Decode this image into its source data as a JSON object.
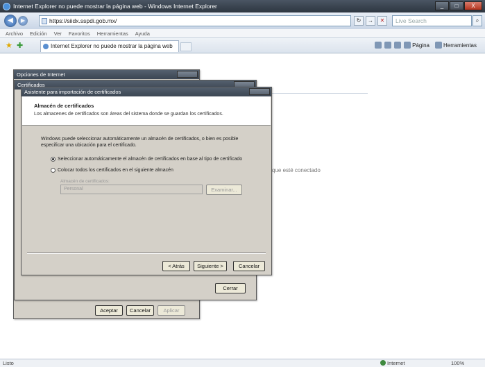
{
  "browser": {
    "title": "Internet Explorer no puede mostrar la página web - Windows Internet Explorer",
    "window_buttons": [
      "_",
      "□",
      "X"
    ],
    "address": "https://siidx.sspdi.gob.mx/",
    "search_placeholder": "Live Search",
    "menu": [
      "Archivo",
      "Edición",
      "Ver",
      "Favoritos",
      "Herramientas",
      "Ayuda"
    ],
    "tab_title": "Internet Explorer no puede mostrar la página web",
    "toolbar": {
      "page": "Página",
      "tools": "Herramientas"
    },
    "status_left": "Listo",
    "status_zone": "Internet",
    "zoom": "100%"
  },
  "page": {
    "background_text": "que esté conectado"
  },
  "dialog_options": {
    "title": "Opciones de Internet",
    "buttons": {
      "accept": "Aceptar",
      "cancel": "Cancelar",
      "apply": "Aplicar"
    }
  },
  "dialog_certificates": {
    "title": "Certificados",
    "buttons": {
      "close": "Cerrar"
    }
  },
  "wizard": {
    "title": "Asistente para importación de certificados",
    "heading": "Almacén de certificados",
    "subheading": "Los almacenes de certificados son áreas del sistema donde se guardan los certificados.",
    "body_text": "Windows puede seleccionar automáticamente un almacén de certificados, o bien es posible especificar una ubicación para el certificado.",
    "option_auto": "Seleccionar automáticamente el almacén de certificados en base al tipo de certificado",
    "option_manual": "Colocar todos los certificados en el siguiente almacén",
    "store_label": "Almacén de certificados:",
    "store_value": "Personal",
    "browse": "Examinar...",
    "back": "< Atrás",
    "next": "Siguiente >",
    "cancel": "Cancelar"
  },
  "colors": {
    "titlebar": "#3c4653",
    "dialog_face": "#d4d0c8",
    "accent": "#2f62a8"
  }
}
